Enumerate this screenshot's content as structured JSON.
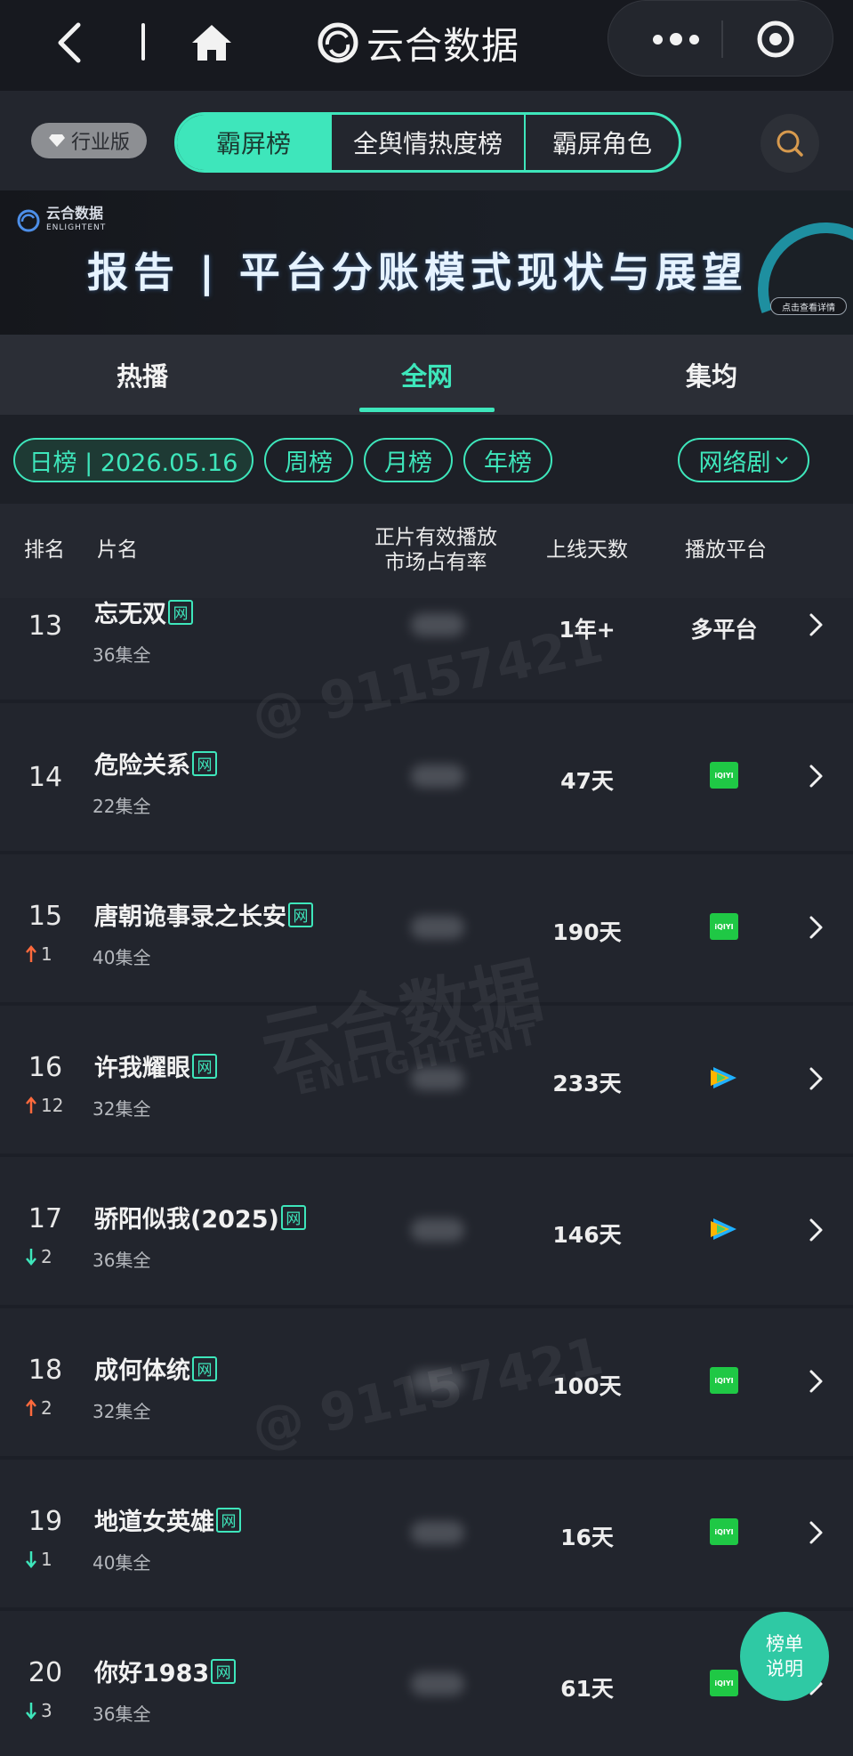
{
  "app": {
    "title": "云合数据"
  },
  "nav": {
    "back_icon": "chevron-left-icon",
    "home_icon": "home-icon",
    "more_icon": "more-dots-icon",
    "close_icon": "target-close-icon"
  },
  "edition_badge": "行业版",
  "main_tabs": [
    {
      "label": "霸屏榜",
      "active": true
    },
    {
      "label": "全舆情热度榜",
      "active": false
    },
    {
      "label": "霸屏角色",
      "active": false
    }
  ],
  "banner": {
    "brand": "云合数据",
    "brand_sub": "ENLIGHTENT",
    "headline": "报告 | 平台分账模式现状与展望",
    "cta": "点击查看详情"
  },
  "view_tabs": [
    {
      "label": "热播",
      "active": false
    },
    {
      "label": "全网",
      "active": true
    },
    {
      "label": "集均",
      "active": false
    }
  ],
  "filters": {
    "daily": "日榜 | 2026.05.16",
    "weekly": "周榜",
    "monthly": "月榜",
    "yearly": "年榜",
    "category": "网络剧"
  },
  "columns": {
    "rank": "排名",
    "title": "片名",
    "share_line1": "正片有效播放",
    "share_line2": "市场占有率",
    "days": "上线天数",
    "platform": "播放平台"
  },
  "tag_label": "网",
  "iqiyi_label": "iQIYI",
  "rows": [
    {
      "rank": "13",
      "change": "",
      "direction": "none",
      "title": "忘无双",
      "episodes": "36集全",
      "days": "1年+",
      "platform": "多平台",
      "platform_icon": "text"
    },
    {
      "rank": "14",
      "change": "",
      "direction": "none",
      "title": "危险关系",
      "episodes": "22集全",
      "days": "47天",
      "platform": "",
      "platform_icon": "iqiyi-icon"
    },
    {
      "rank": "15",
      "change": "1",
      "direction": "up",
      "title": "唐朝诡事录之长安",
      "episodes": "40集全",
      "days": "190天",
      "platform": "",
      "platform_icon": "iqiyi-icon"
    },
    {
      "rank": "16",
      "change": "12",
      "direction": "up",
      "title": "许我耀眼",
      "episodes": "32集全",
      "days": "233天",
      "platform": "",
      "platform_icon": "tencent-video-icon"
    },
    {
      "rank": "17",
      "change": "2",
      "direction": "down",
      "title": "骄阳似我(2025)",
      "episodes": "36集全",
      "days": "146天",
      "platform": "",
      "platform_icon": "tencent-video-icon"
    },
    {
      "rank": "18",
      "change": "2",
      "direction": "up",
      "title": "成何体统",
      "episodes": "32集全",
      "days": "100天",
      "platform": "",
      "platform_icon": "iqiyi-icon"
    },
    {
      "rank": "19",
      "change": "1",
      "direction": "down",
      "title": "地道女英雄",
      "episodes": "40集全",
      "days": "16天",
      "platform": "",
      "platform_icon": "iqiyi-icon"
    },
    {
      "rank": "20",
      "change": "3",
      "direction": "down",
      "title": "你好1983",
      "episodes": "36集全",
      "days": "61天",
      "platform": "",
      "platform_icon": "iqiyi-icon"
    }
  ],
  "fab": {
    "line1": "榜单",
    "line2": "说明"
  },
  "watermark": {
    "brand": "云合数据",
    "brand_en": "ENLIGHTENT",
    "account": "@ 91157421"
  },
  "colors": {
    "accent": "#3ee6bb",
    "up": "#ff6a3d",
    "down": "#3ee6bb",
    "iqiyi": "#1fc845",
    "background": "#1c1f27"
  }
}
